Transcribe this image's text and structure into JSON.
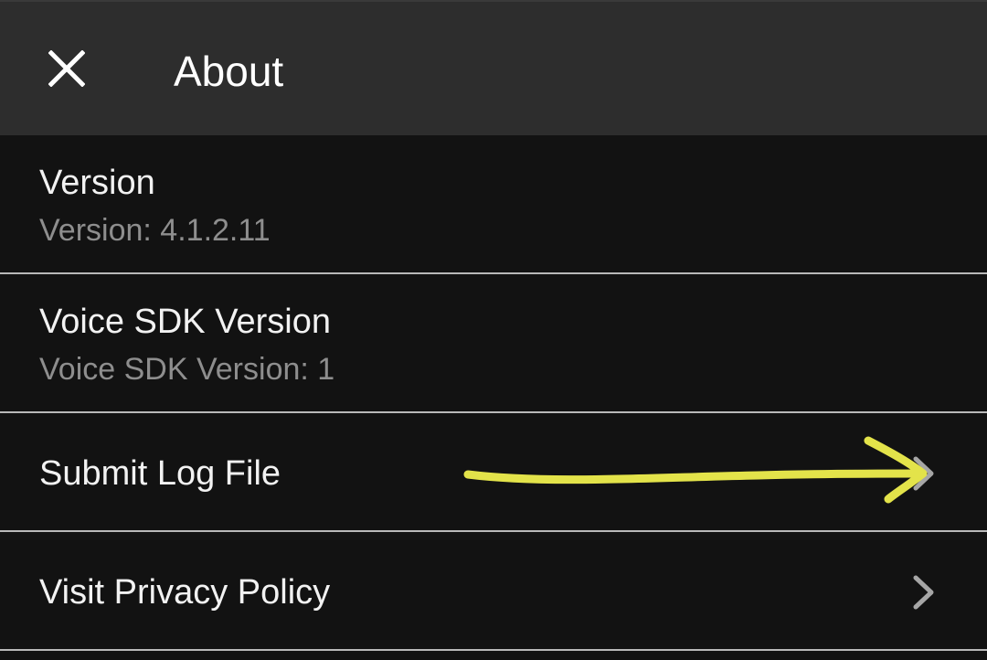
{
  "app_bar": {
    "title": "About",
    "close_icon": "close-icon"
  },
  "items": [
    {
      "title": "Version",
      "subtitle": "Version: 4.1.2.11"
    },
    {
      "title": "Voice SDK Version",
      "subtitle": "Voice SDK Version: 1"
    },
    {
      "title": "Submit Log File",
      "icon": "chevron-right-icon"
    },
    {
      "title": "Visit Privacy Policy",
      "icon": "chevron-right-icon"
    }
  ],
  "annotation": {
    "type": "hand-drawn-arrow",
    "color": "#e3e34a"
  },
  "colors": {
    "app_bar_bg": "#2d2d2d",
    "background": "#121212",
    "divider": "#b9b9b9",
    "title_text": "#f2f2f2",
    "subtitle_text": "#8e8e8e",
    "chevron": "#a6a6a6"
  }
}
